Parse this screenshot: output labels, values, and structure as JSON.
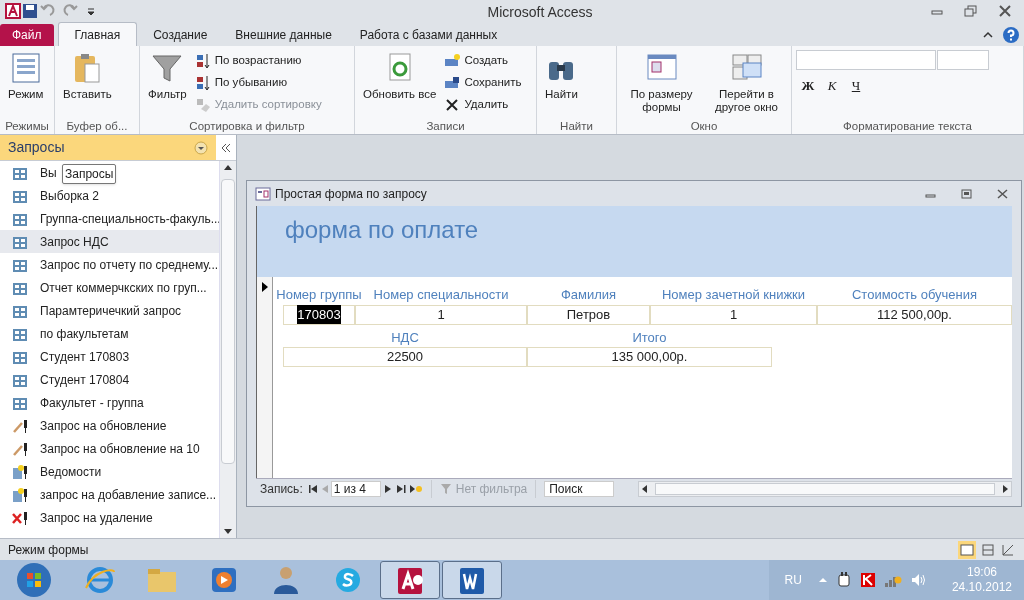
{
  "window": {
    "title": "Microsoft Access"
  },
  "tabs": [
    {
      "label": "Файл",
      "kind": "file",
      "selected": false
    },
    {
      "label": "Главная",
      "kind": "normal",
      "selected": true
    },
    {
      "label": "Создание",
      "kind": "normal",
      "selected": false
    },
    {
      "label": "Внешние данные",
      "kind": "normal",
      "selected": false
    },
    {
      "label": "Работа с базами данных",
      "kind": "normal",
      "selected": false
    }
  ],
  "ribbon_groups": [
    {
      "label": "Режимы",
      "items": [
        {
          "label": "Режим",
          "kind": "large",
          "disabled": false
        }
      ]
    },
    {
      "label": "Буфер об...",
      "items": [
        {
          "label": "Вставить",
          "kind": "large",
          "disabled": false
        }
      ]
    },
    {
      "label": "Сортировка и фильтр",
      "items": [
        {
          "label": "Фильтр",
          "kind": "large",
          "disabled": false
        },
        {
          "label": "По возрастанию",
          "kind": "small",
          "disabled": false
        },
        {
          "label": "По убыванию",
          "kind": "small",
          "disabled": false
        },
        {
          "label": "Удалить сортировку",
          "kind": "small",
          "disabled": true
        }
      ]
    },
    {
      "label": "Записи",
      "items": [
        {
          "label": "Обновить все",
          "kind": "large",
          "disabled": false
        },
        {
          "label": "Создать",
          "kind": "small",
          "disabled": false
        },
        {
          "label": "Сохранить",
          "kind": "small",
          "disabled": false
        },
        {
          "label": "Удалить",
          "kind": "small",
          "disabled": false
        }
      ]
    },
    {
      "label": "Найти",
      "items": [
        {
          "label": "Найти",
          "kind": "large",
          "disabled": false
        }
      ]
    },
    {
      "label": "Окно",
      "items": [
        {
          "label": "По размеру формы",
          "kind": "large",
          "disabled": false
        },
        {
          "label": "Перейти в другое окно",
          "kind": "large",
          "disabled": false
        }
      ]
    },
    {
      "label": "Форматирование текста",
      "items": [
        {
          "label": "Ж",
          "kind": "glyph",
          "disabled": false
        },
        {
          "label": "К",
          "kind": "glyph",
          "disabled": false
        },
        {
          "label": "Ч",
          "kind": "glyph",
          "disabled": false
        }
      ]
    }
  ],
  "nav_pane": {
    "title": "Запросы",
    "tooltip": "Запросы",
    "items": [
      {
        "label": "Вы",
        "kind": "select",
        "selected": false
      },
      {
        "label": "Выборка 2",
        "kind": "select",
        "selected": false
      },
      {
        "label": "Группа-специальность-факуль...",
        "kind": "select",
        "selected": false
      },
      {
        "label": "Запрос НДС",
        "kind": "select",
        "selected": true
      },
      {
        "label": "Запрос по отчету по среднему...",
        "kind": "select",
        "selected": false
      },
      {
        "label": "Отчет коммерчкских по груп...",
        "kind": "select",
        "selected": false
      },
      {
        "label": "Парамтеричечкий запрос",
        "kind": "select",
        "selected": false
      },
      {
        "label": "по факультетам",
        "kind": "select",
        "selected": false
      },
      {
        "label": "Студент 170803",
        "kind": "select",
        "selected": false
      },
      {
        "label": "Студент 170804",
        "kind": "select",
        "selected": false
      },
      {
        "label": "Факультет - группа",
        "kind": "select",
        "selected": false
      },
      {
        "label": "Запрос на обновление",
        "kind": "update",
        "selected": false
      },
      {
        "label": "Запрос на обновление на 10",
        "kind": "update",
        "selected": false
      },
      {
        "label": "Ведомости",
        "kind": "append",
        "selected": false
      },
      {
        "label": "запрос на добавление записе...",
        "kind": "append",
        "selected": false
      },
      {
        "label": "Запрос на удаление",
        "kind": "delete",
        "selected": false
      }
    ]
  },
  "form_window": {
    "title": "Простая форма по запросу",
    "header": "форма по оплате",
    "row_1": [
      {
        "label": "Номер группы",
        "value": "170803",
        "selected": true
      },
      {
        "label": "Номер специальности",
        "value": "1",
        "selected": false
      },
      {
        "label": "Фамилия",
        "value": "Петров",
        "selected": false
      },
      {
        "label": "Номер зачетной книжки",
        "value": "1",
        "selected": false
      },
      {
        "label": "Стоимость обучения",
        "value": "112 500,00р.",
        "selected": false
      }
    ],
    "row_2": [
      {
        "label": "НДС",
        "value": "22500",
        "selected": false
      },
      {
        "label": "Итого",
        "value": "135 000,00р.",
        "selected": false
      }
    ],
    "record_nav": {
      "label": "Запись:",
      "position": "1 из 4",
      "filter": "Нет фильтра",
      "search_placeholder": "Поиск"
    }
  },
  "status_bar": {
    "text": "Режим формы"
  },
  "taskbar": {
    "apps": [
      {
        "kind": "browser",
        "selected": false
      },
      {
        "kind": "folder",
        "selected": false
      },
      {
        "kind": "media",
        "selected": false
      },
      {
        "kind": "user",
        "selected": false
      },
      {
        "kind": "skype",
        "selected": false
      },
      {
        "kind": "access",
        "selected": true
      },
      {
        "kind": "word",
        "selected": true
      }
    ],
    "language": "RU",
    "time": "19:06",
    "date": "24.10.2012"
  }
}
